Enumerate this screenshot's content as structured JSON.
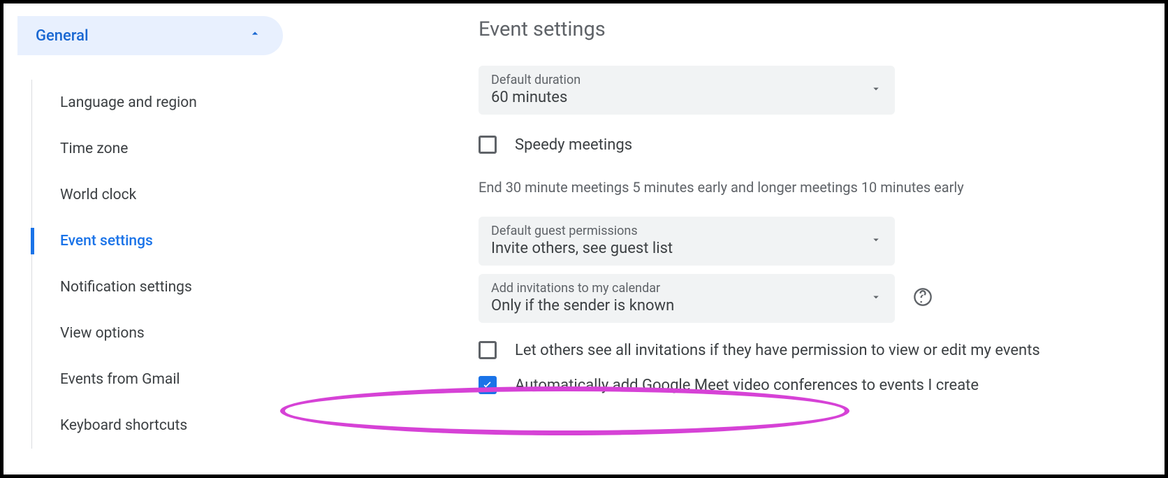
{
  "sidebar": {
    "header": "General",
    "items": [
      {
        "label": "Language and region",
        "active": false
      },
      {
        "label": "Time zone",
        "active": false
      },
      {
        "label": "World clock",
        "active": false
      },
      {
        "label": "Event settings",
        "active": true
      },
      {
        "label": "Notification settings",
        "active": false
      },
      {
        "label": "View options",
        "active": false
      },
      {
        "label": "Events from Gmail",
        "active": false
      },
      {
        "label": "Keyboard shortcuts",
        "active": false
      }
    ]
  },
  "main": {
    "title": "Event settings",
    "default_duration": {
      "label": "Default duration",
      "value": "60 minutes"
    },
    "speedy_meetings": {
      "label": "Speedy meetings",
      "checked": false,
      "hint": "End 30 minute meetings 5 minutes early and longer meetings 10 minutes early"
    },
    "guest_permissions": {
      "label": "Default guest permissions",
      "value": "Invite others, see guest list"
    },
    "add_invitations": {
      "label": "Add invitations to my calendar",
      "value": "Only if the sender is known"
    },
    "let_others_see": {
      "label": "Let others see all invitations if they have permission to view or edit my events",
      "checked": false
    },
    "auto_meet": {
      "label": "Automatically add Google Meet video conferences to events I create",
      "checked": true
    }
  }
}
